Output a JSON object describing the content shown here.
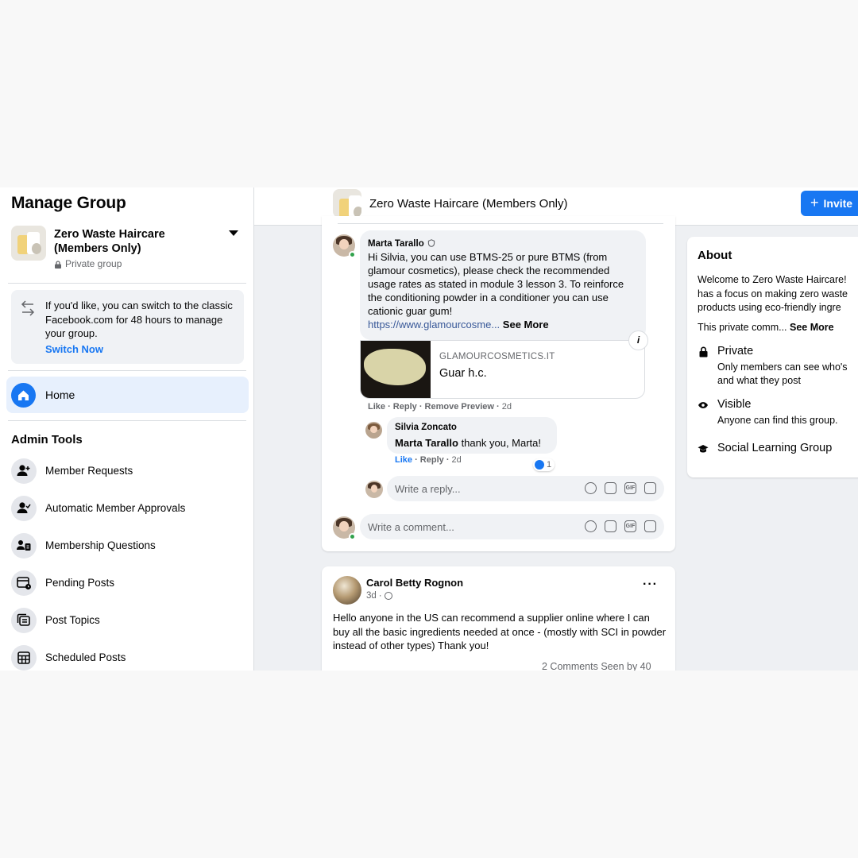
{
  "sidebar": {
    "title": "Manage Group",
    "group_name": "Zero Waste Haircare (Members Only)",
    "privacy": "Private group",
    "switch_text": "If you'd like, you can switch to the classic Facebook.com for 48 hours to manage your group.",
    "switch_link": "Switch Now",
    "home_label": "Home",
    "admin_tools_title": "Admin Tools",
    "admin_items": [
      {
        "label": "Member Requests",
        "icon": "member-requests-icon"
      },
      {
        "label": "Automatic Member Approvals",
        "icon": "auto-approve-icon"
      },
      {
        "label": "Membership Questions",
        "icon": "membership-questions-icon"
      },
      {
        "label": "Pending Posts",
        "icon": "pending-posts-icon"
      },
      {
        "label": "Post Topics",
        "icon": "post-topics-icon"
      },
      {
        "label": "Scheduled Posts",
        "icon": "scheduled-posts-icon"
      }
    ]
  },
  "topbar": {
    "title": "Zero Waste Haircare (Members Only)",
    "invite_label": "Invite"
  },
  "comment": {
    "author": "Marta Tarallo",
    "text": "Hi Silvia, you can use BTMS-25 or pure BTMS (from glamour cosmetics), please check the recommended usage rates as stated in module 3 lesson 3. To reinforce the conditioning powder in a conditioner you can use cationic guar gum!",
    "link": "https://www.glamourcosme...",
    "see_more": "See More",
    "preview_domain": "GLAMOURCOSMETICS.IT",
    "preview_title": "Guar h.c.",
    "actions": {
      "like": "Like",
      "reply": "Reply",
      "remove_preview": "Remove Preview",
      "time": "2d"
    }
  },
  "reply": {
    "author": "Silvia Zoncato",
    "mention": "Marta Tarallo",
    "text": " thank you, Marta!",
    "actions": {
      "like": "Like",
      "reply": "Reply",
      "time": "2d"
    },
    "reaction_count": "1"
  },
  "reply_input_placeholder": "Write a reply...",
  "comment_input_placeholder": "Write a comment...",
  "post": {
    "author": "Carol Betty Rognon",
    "time": "3d",
    "text": "Hello anyone in the US can recommend a supplier online where I can buy all the basic ingredients needed at once - (mostly with SCI in powder instead of other types) Thank you!",
    "stats": "2 Comments  Seen by 40"
  },
  "about": {
    "title": "About",
    "description_lines": [
      "Welcome to Zero Waste Haircare!",
      "has a focus on making zero waste",
      "products using eco-friendly ingre"
    ],
    "short": "This private comm...",
    "see_more": "See More",
    "private_head": "Private",
    "private_sub_lines": [
      "Only members can see who's",
      "and what they post"
    ],
    "visible_head": "Visible",
    "visible_sub": "Anyone can find this group.",
    "type_head": "Social Learning Group"
  },
  "colors": {
    "accent": "#1877f2",
    "highlight": "#e7f0fd"
  }
}
